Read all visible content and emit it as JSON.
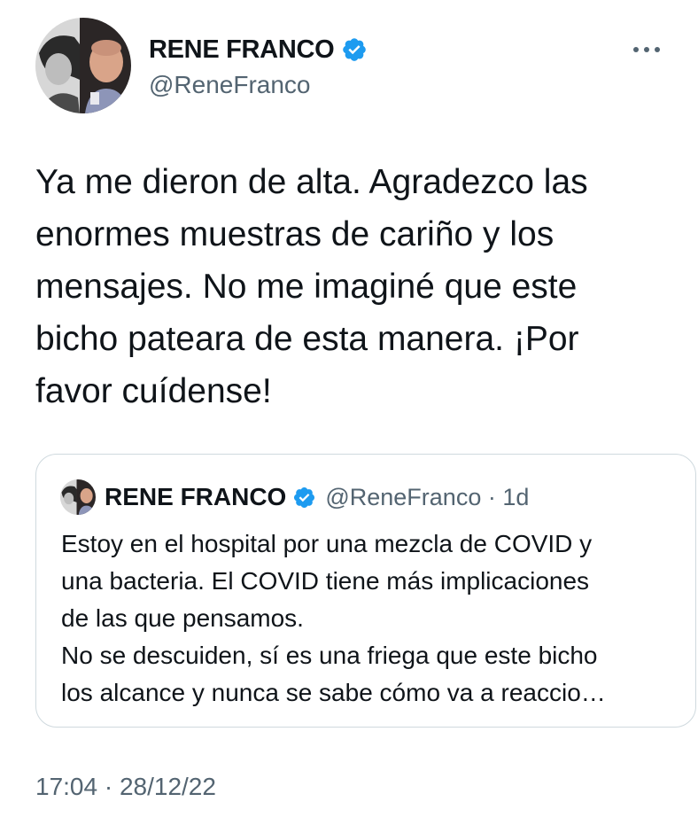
{
  "author": {
    "display_name": "RENE FRANCO",
    "handle": "@ReneFranco",
    "verified": true
  },
  "more_icon": "more-horizontal-icon",
  "tweet": {
    "lines": [
      "Ya me dieron de alta. Agradezco las",
      "enormes muestras de cariño y los",
      "mensajes. No me imaginé que este",
      "bicho pateara de esta manera. ¡Por",
      "favor cuídense!"
    ],
    "timestamp": "17:04 · 28/12/22"
  },
  "quoted": {
    "display_name": "RENE FRANCO",
    "handle_and_age": "@ReneFranco · 1d",
    "lines": [
      "Estoy en el hospital por una mezcla de COVID y",
      "una bacteria. El COVID tiene más implicaciones",
      "de las que pensamos.",
      "No se descuiden, sí es una friega que este bicho",
      "los alcance y nunca se sabe cómo va a reaccio…"
    ]
  },
  "colors": {
    "verified_blue": "#1d9bf0",
    "text_primary": "#0f1419",
    "text_secondary": "#536471",
    "border": "#cfd9de"
  }
}
